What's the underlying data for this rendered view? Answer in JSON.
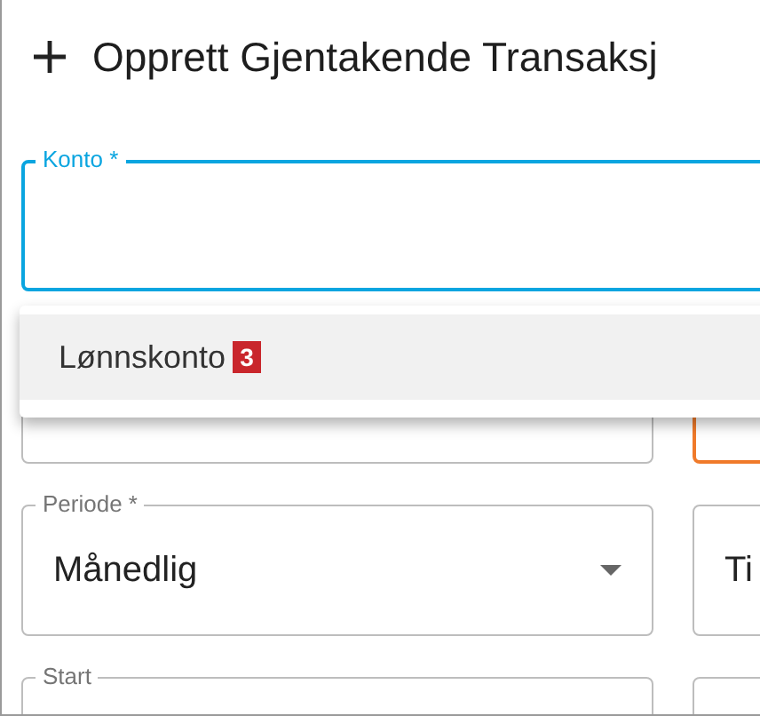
{
  "dialog": {
    "title": "Opprett Gjentakende Transaksj"
  },
  "konto_field": {
    "label": "Konto *",
    "focused": true
  },
  "menu": {
    "items": [
      {
        "label": "Lønnskonto",
        "badge": "3",
        "selected": true
      }
    ]
  },
  "rows": [
    {
      "left": {
        "kind": "input",
        "focused": false
      },
      "right": {
        "focused": true
      }
    },
    {
      "left": {
        "kind": "select",
        "label": "Periode *",
        "value": "Månedlig",
        "focused": false
      },
      "right": {
        "value": "Ti",
        "focused": false
      }
    },
    {
      "left": {
        "kind": "input",
        "label": "Start",
        "focused": false
      },
      "right": {
        "focused": false
      }
    }
  ]
}
